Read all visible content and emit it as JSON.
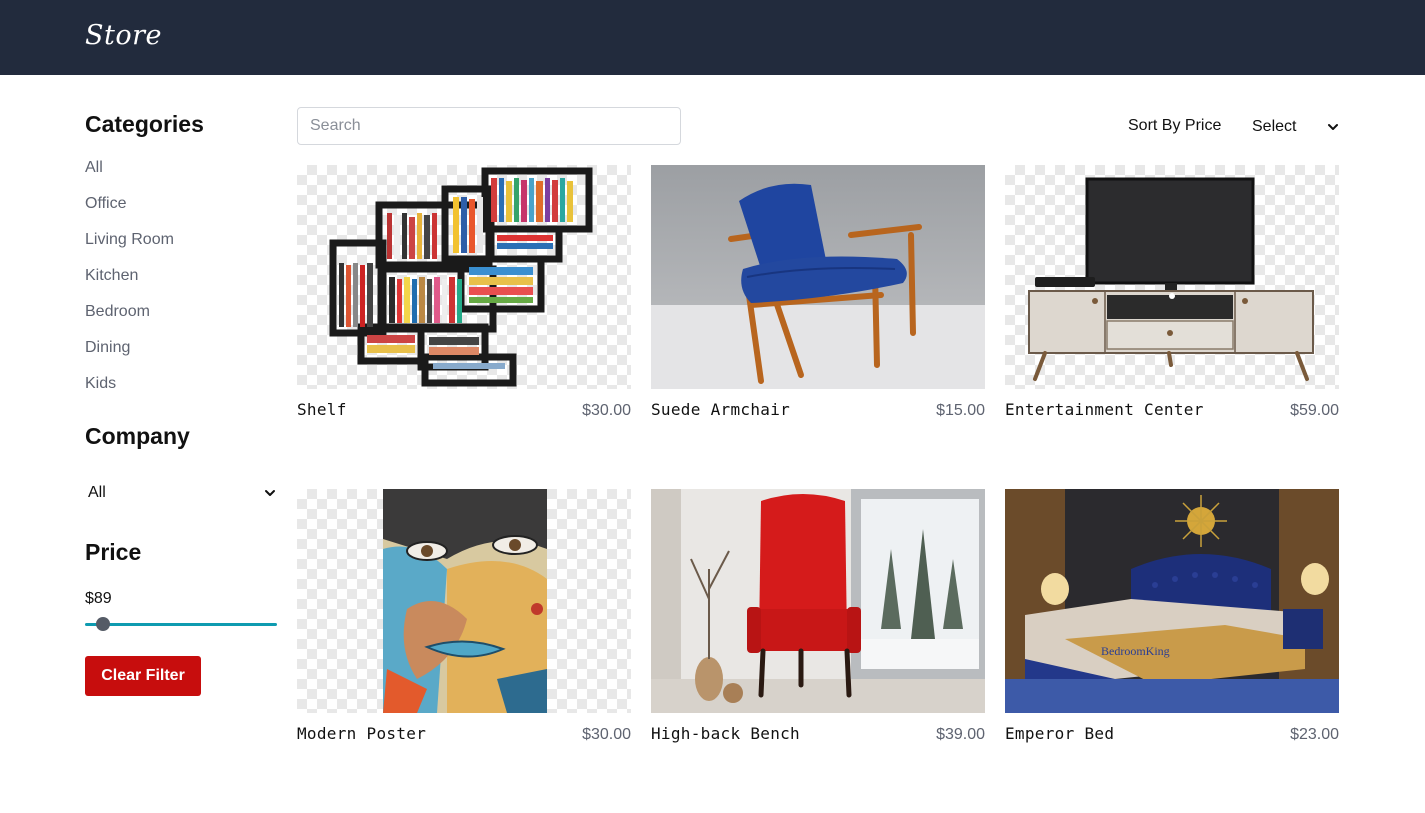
{
  "header": {
    "brand": "Store"
  },
  "sidebar": {
    "categories_title": "Categories",
    "categories": [
      "All",
      "Office",
      "Living Room",
      "Kitchen",
      "Bedroom",
      "Dining",
      "Kids"
    ],
    "company_title": "Company",
    "company_selected": "All",
    "price_title": "Price",
    "price_value": "$89",
    "price_slider_fraction": 0.06,
    "clear_label": "Clear Filter"
  },
  "toolbar": {
    "search_placeholder": "Search",
    "sort_label": "Sort By Price",
    "sort_selected": "Select"
  },
  "products": [
    {
      "name": "Shelf",
      "price": "$30.00"
    },
    {
      "name": "Suede Armchair",
      "price": "$15.00"
    },
    {
      "name": "Entertainment Center",
      "price": "$59.00"
    },
    {
      "name": "Modern Poster",
      "price": "$30.00"
    },
    {
      "name": "High-back Bench",
      "price": "$39.00"
    },
    {
      "name": "Emperor Bed",
      "price": "$23.00"
    }
  ],
  "colors": {
    "header_bg": "#222b3d",
    "accent": "#0e9bb0",
    "clear_button": "#c70d0d"
  }
}
